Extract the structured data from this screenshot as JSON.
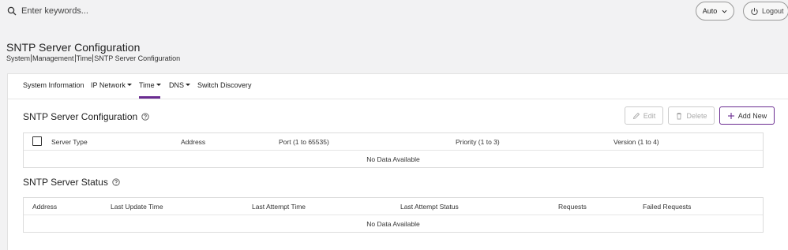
{
  "topbar": {
    "search_placeholder": "Enter keywords...",
    "auto_label": "Auto",
    "logout_label": "Logout"
  },
  "header": {
    "title": "SNTP Server Configuration",
    "breadcrumb": [
      "System",
      "Management",
      "Time",
      "SNTP Server Configuration"
    ]
  },
  "tabs": [
    {
      "label": "System Information",
      "has_dropdown": false,
      "active": false
    },
    {
      "label": "IP Network",
      "has_dropdown": true,
      "active": false
    },
    {
      "label": "Time",
      "has_dropdown": true,
      "active": true
    },
    {
      "label": "DNS",
      "has_dropdown": true,
      "active": false
    },
    {
      "label": "Switch Discovery",
      "has_dropdown": false,
      "active": false
    }
  ],
  "config_section": {
    "title": "SNTP Server Configuration",
    "edit_label": "Edit",
    "delete_label": "Delete",
    "add_label": "Add New",
    "columns": [
      "Server Type",
      "Address",
      "Port (1 to 65535)",
      "Priority (1 to 3)",
      "Version (1 to 4)"
    ],
    "empty_text": "No Data Available"
  },
  "status_section": {
    "title": "SNTP Server Status",
    "columns": [
      "Address",
      "Last Update Time",
      "Last Attempt Time",
      "Last Attempt Status",
      "Requests",
      "Failed Requests"
    ],
    "empty_text": "No Data Available"
  },
  "colors": {
    "accent": "#6a2c91",
    "background": "#f2f2f3",
    "card": "#ffffff"
  }
}
